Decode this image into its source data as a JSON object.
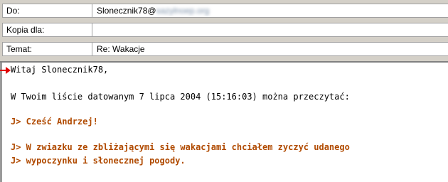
{
  "header": {
    "to": {
      "label": "Do:",
      "value": "Slonecznik78@",
      "value_blurred": "sazylnoep.org"
    },
    "cc": {
      "label": "Kopia dla:",
      "value": ""
    },
    "subject": {
      "label": "Temat:",
      "value": "Re: Wakacje"
    }
  },
  "body": {
    "lines": [
      "Witaj Slonecznik78,",
      "W Twoim liście datowanym 7 lipca 2004 (15:16:03) można przeczytać:",
      "J> Cześć Andrzej!",
      "J> W zwiazku ze zbliżającymi się wakacjami chciałem zyczyć udanego",
      "J> wypoczynku i słonecznej pogody."
    ]
  },
  "colors": {
    "quote": "#b04a00",
    "pointer": "#e00000"
  }
}
